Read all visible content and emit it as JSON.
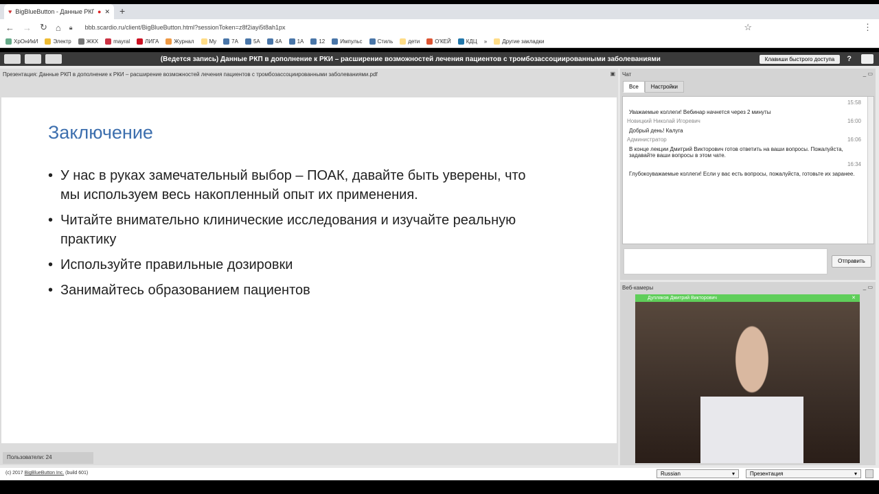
{
  "browser": {
    "tab_title": "BigBlueButton - Данные РКП",
    "url": "bbb.scardio.ru/client/BigBlueButton.html?sessionToken=z8f2iayi5t8ah1px",
    "bookmarks": [
      "ХрОнИкИ",
      "Электр",
      "ЖКХ",
      "mayral",
      "ЛИГА",
      "Журнал",
      "My",
      "7А",
      "5А",
      "4А",
      "1А",
      "12",
      "Импульс",
      "Стиль",
      "дети",
      "О'КЕЙ",
      "КДЦ",
      "»",
      "Другие закладки"
    ]
  },
  "app": {
    "title": "(Ведется запись) Данные РКП в дополнение к РКИ – расширение возможностей лечения пациентов с тромбозассоциированными заболеваниями",
    "shortcuts": "Клавиши быстрого доступа",
    "help": "?"
  },
  "presentation": {
    "title": "Презентация: Данные РКП в дополнение к РКИ – расширение возможностей лечения пациентов с тромбозассоциированными заболеваниями.pdf",
    "slide_heading": "Заключение",
    "bullets": [
      "У нас в руках замечательный выбор – ПОАК, давайте быть уверены, что мы используем весь накопленный опыт их применения.",
      "Читайте внимательно клинические исследования и изучайте реальную практику",
      "Используйте правильные дозировки",
      " Занимайтесь образованием пациентов"
    ],
    "users": "Пользователи: 24"
  },
  "chat": {
    "title": "Чат",
    "tabs": [
      "Все",
      "Настройки"
    ],
    "messages": [
      {
        "author": "",
        "time": "15:58",
        "text": "Уважаемые коллеги! Вебинар начнется через 2 минуты"
      },
      {
        "author": "Новицкий Николай Игоревич",
        "time": "16:00",
        "text": "Добрый день! Калуга"
      },
      {
        "author": "Администратор",
        "time": "16:06",
        "text": "В конце лекции Дмитрий Викторович готов ответить на ваши вопросы. Пожалуйста, задавайте ваши вопросы в этом чате."
      },
      {
        "author": "",
        "time": "16:34",
        "text": "Глубокоуважаемые коллеги! Если у вас есть вопросы, пожалуйста, готовьте их заранее."
      }
    ],
    "send": "Отправить"
  },
  "webcams": {
    "title": "Веб-камеры",
    "presenter": "Дупляков Дмитрий Викторович"
  },
  "footer": {
    "copyright": "(c) 2017 ",
    "link": "BigBlueButton Inc.",
    "build": " (build 601)",
    "language": "Russian",
    "layout": "Презентация"
  }
}
